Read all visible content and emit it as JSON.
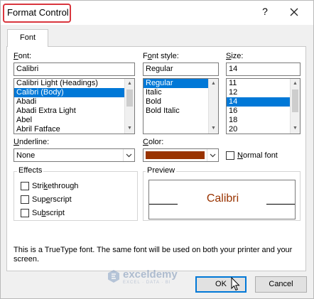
{
  "window": {
    "title": "Format Control",
    "help_glyph": "?",
    "close_icon": "close-icon"
  },
  "tab": {
    "label": "Font"
  },
  "font": {
    "label": "Font:",
    "label_mnemonic": "F",
    "label_rest": "ont:",
    "value": "Calibri",
    "items": [
      "Calibri Light (Headings)",
      "Calibri (Body)",
      "Abadi",
      "Abadi Extra Light",
      "Abel",
      "Abril Fatface"
    ],
    "selected": "Calibri (Body)"
  },
  "font_style": {
    "label_pre": "F",
    "label_mnemonic": "o",
    "label_rest": "nt style:",
    "value": "Regular",
    "items": [
      "Regular",
      "Italic",
      "Bold",
      "Bold Italic"
    ],
    "selected": "Regular"
  },
  "size": {
    "label_mnemonic": "S",
    "label_rest": "ize:",
    "value": "14",
    "items": [
      "11",
      "12",
      "14",
      "16",
      "18",
      "20"
    ],
    "selected": "14"
  },
  "underline": {
    "label_mnemonic": "U",
    "label_rest": "nderline:",
    "value": "None"
  },
  "color": {
    "label_mnemonic": "C",
    "label_rest": "olor:",
    "swatch": "#993300"
  },
  "normal_font": {
    "label_mnemonic": "N",
    "label_rest": "ormal font",
    "checked": false
  },
  "effects": {
    "label": "Effects",
    "items": [
      {
        "pre": "Stri",
        "mnemonic": "k",
        "rest": "ethrough",
        "checked": false
      },
      {
        "pre": "Sup",
        "mnemonic": "e",
        "rest": "rscript",
        "checked": false
      },
      {
        "pre": "Su",
        "mnemonic": "b",
        "rest": "script",
        "checked": false
      }
    ]
  },
  "preview": {
    "label": "Preview",
    "sample_text": "Calibri",
    "sample_color": "#993300"
  },
  "info_text": "This is a TrueType font.  The same font will be used on both your printer and your screen.",
  "watermark": {
    "name": "exceldemy",
    "tagline": "EXCEL · DATA · BI"
  },
  "buttons": {
    "ok": "OK",
    "cancel": "Cancel"
  },
  "colors": {
    "accent": "#0078d7",
    "title_highlight": "#d9363e"
  }
}
